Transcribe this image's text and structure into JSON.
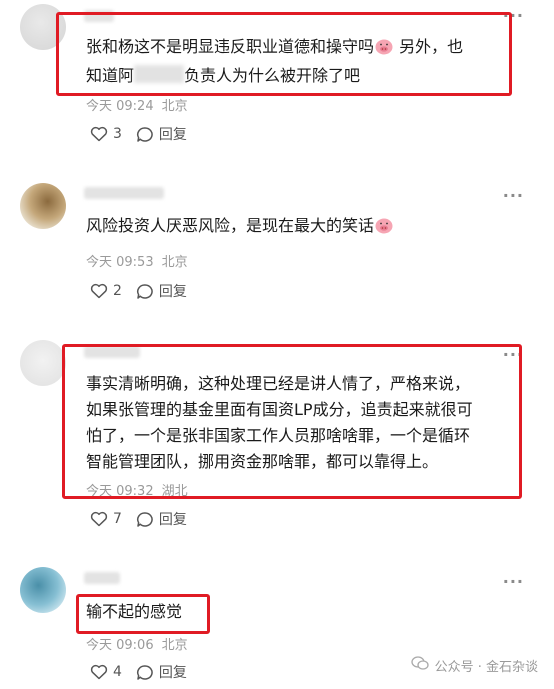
{
  "comments": [
    {
      "text_a": "张和杨这不是明显违反职业道德和操守吗",
      "text_b": " 另外，也",
      "text_c": "知道阿",
      "text_d": "负责人为什么被开除了吧",
      "time": "今天 09:24",
      "location": "北京",
      "likes": "3",
      "reply_label": "回复"
    },
    {
      "text": "风险投资人厌恶风险，是现在最大的笑话",
      "time": "今天 09:53",
      "location": "北京",
      "likes": "2",
      "reply_label": "回复"
    },
    {
      "lines": [
        "事实清晰明确，这种处理已经是讲人情了，严格来说，",
        "如果张管理的基金里面有国资LP成分，追责起来就很可",
        "怕了，一个是张非国家工作人员那啥啥罪，一个是循环",
        "智能管理团队，挪用资金那啥罪，都可以靠得上。"
      ],
      "time": "今天 09:32",
      "location": "湖北",
      "likes": "7",
      "reply_label": "回复"
    },
    {
      "text": "输不起的感觉",
      "time": "今天 09:06",
      "location": "北京",
      "likes": "4",
      "reply_label": "回复"
    }
  ],
  "watermark": "公众号 · 金石杂谈",
  "colors": {
    "highlight": "#e01b24",
    "meta": "#9a9a9a"
  },
  "icons": [
    "heart-icon",
    "comment-icon",
    "more-icon",
    "emoji-icon",
    "wechat-icon"
  ]
}
